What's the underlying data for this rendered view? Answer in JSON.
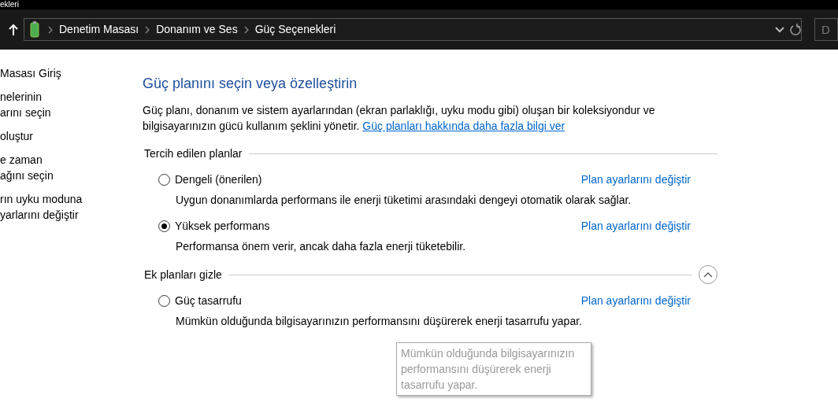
{
  "window": {
    "title": "ekleri"
  },
  "address_bar": {
    "breadcrumbs": [
      "Denetim Masası",
      "Donanım ve Ses",
      "Güç Seçenekleri"
    ]
  },
  "search": {
    "placeholder": "D"
  },
  "sidebar": {
    "items": [
      {
        "lines": [
          "Masası Giriş"
        ]
      },
      {
        "lines": [
          "nelerinin",
          "arını seçin"
        ]
      },
      {
        "lines": [
          "oluştur"
        ]
      },
      {
        "lines": [
          "e zaman",
          "ağını seçin"
        ]
      },
      {
        "lines": [
          "rın uyku moduna",
          "yarlarını değiştir"
        ]
      }
    ]
  },
  "main": {
    "heading": "Güç planını seçin veya özelleştirin",
    "intro": "Güç planı, donanım ve sistem ayarlarından (ekran parlaklığı, uyku modu gibi) oluşan bir koleksiyondur ve bilgisayarınızın gücü kullanım şeklini yönetir.",
    "intro_link": "Güç planları hakkında daha fazla bilgi ver",
    "sections": [
      {
        "title": "Tercih edilen planlar",
        "plans": [
          {
            "name": "Dengeli (önerilen)",
            "selected": false,
            "link": "Plan ayarlarını değiştir",
            "description": "Uygun donanımlarda performans ile enerji tüketimi arasındaki dengeyi otomatik olarak sağlar."
          },
          {
            "name": "Yüksek performans",
            "selected": true,
            "link": "Plan ayarlarını değiştir",
            "description": "Performansa önem verir, ancak daha fazla enerji tüketebilir."
          }
        ]
      },
      {
        "title": "Ek planları gizle",
        "toggle": {
          "expanded": true
        },
        "plans": [
          {
            "name": "Güç tasarrufu",
            "selected": false,
            "link": "Plan ayarlarını değiştir",
            "description": "Mümkün olduğunda bilgisayarınızın performansını düşürerek enerji tasarrufu yapar."
          }
        ]
      }
    ]
  },
  "tooltip": {
    "text": "Mümkün olduğunda bilgisayarınızın performansını düşürerek enerji tasarrufu yapar."
  }
}
